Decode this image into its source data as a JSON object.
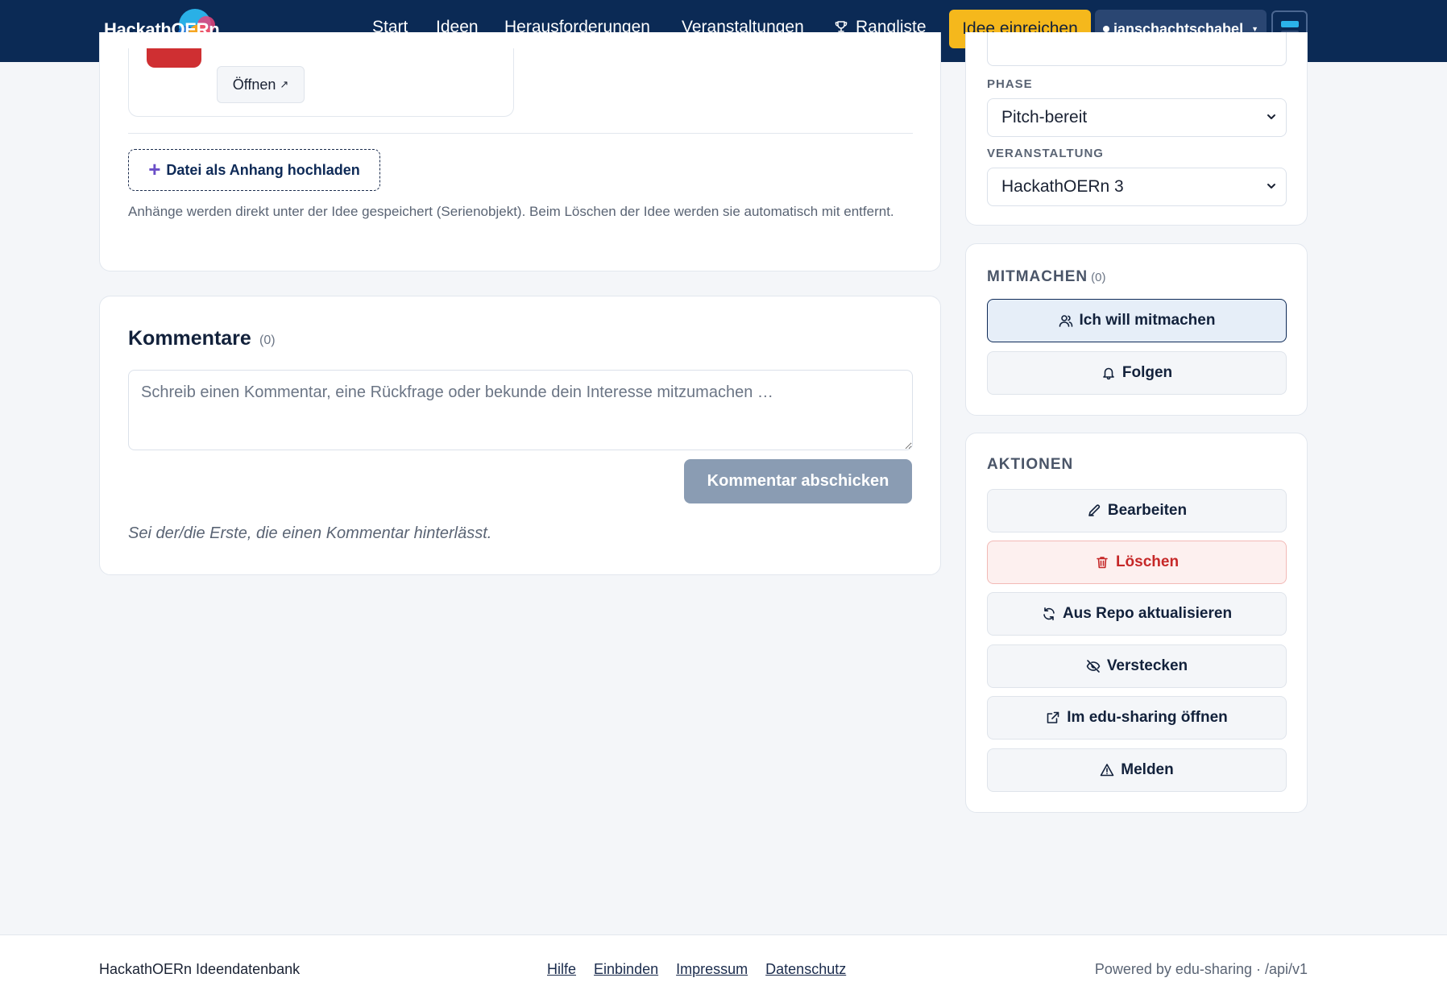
{
  "header": {
    "logo_text": "HackathOERn",
    "nav": [
      "Start",
      "Ideen",
      "Herausforderungen",
      "Veranstaltungen",
      "Rangliste"
    ],
    "submit_label": "Idee einreichen",
    "user_name": "janschachtschabel"
  },
  "attachments": {
    "open_label": "Öffnen",
    "upload_label": "Datei als Anhang hochladen",
    "note": "Anhänge werden direkt unter der Idee gespeichert (Serienobjekt). Beim Löschen der Idee werden sie automatisch mit entfernt."
  },
  "comments": {
    "title": "Kommentare",
    "count": "(0)",
    "placeholder": "Schreib einen Kommentar, eine Rückfrage oder bekunde dein Interesse mitzumachen …",
    "send_label": "Kommentar abschicken",
    "empty_note": "Sei der/die Erste, die einen Kommentar hinterlässt."
  },
  "meta": {
    "phase_label": "PHASE",
    "phase_value": "Pitch-bereit",
    "event_label": "VERANSTALTUNG",
    "event_value": "HackathOERn 3"
  },
  "join": {
    "title": "MITMACHEN",
    "count": "(0)",
    "join_label": "Ich will mitmachen",
    "follow_label": "Folgen"
  },
  "actions": {
    "title": "AKTIONEN",
    "edit": "Bearbeiten",
    "delete": "Löschen",
    "refresh": "Aus Repo aktualisieren",
    "hide": "Verstecken",
    "open_edu": "Im edu-sharing öffnen",
    "report": "Melden"
  },
  "footer": {
    "left": "HackathOERn Ideendatenbank",
    "links": [
      "Hilfe",
      "Einbinden",
      "Impressum",
      "Datenschutz"
    ],
    "right": "Powered by edu-sharing · /api/v1"
  },
  "colors": {
    "header_bg": "#0b2a55",
    "accent_yellow": "#f5b81c",
    "danger": "#c62828",
    "send_button": "#8a9cb3"
  }
}
